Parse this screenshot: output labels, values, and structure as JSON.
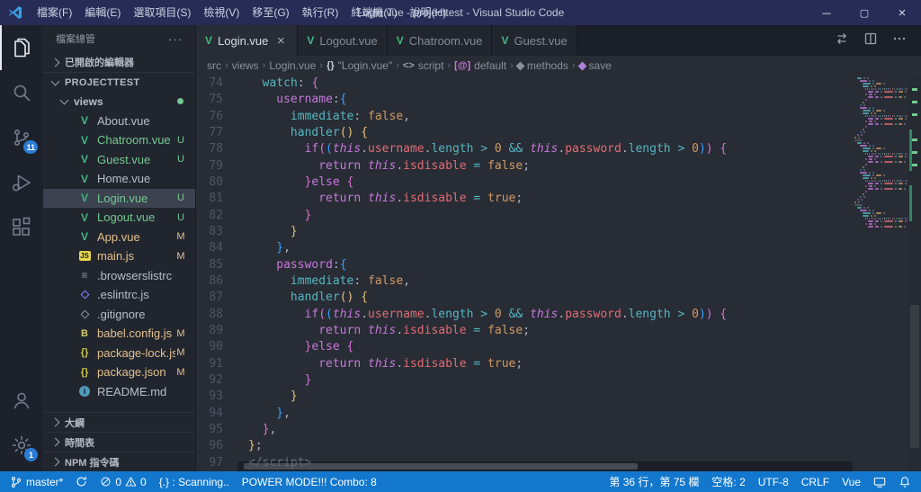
{
  "title_bar": {
    "title": "Login.vue - projecttest - Visual Studio Code",
    "menus": [
      "檔案(F)",
      "編輯(E)",
      "選取項目(S)",
      "檢視(V)",
      "移至(G)",
      "執行(R)",
      "終端機(T)",
      "說明(H)"
    ]
  },
  "activity_bar": {
    "scm_badge": "11",
    "settings_badge": "1",
    "icons": [
      "files",
      "search",
      "source-control",
      "run-and-debug",
      "extensions",
      "account",
      "settings"
    ]
  },
  "sidebar": {
    "title": "檔案總管",
    "sections": {
      "open_editors": "已開啟的編輯器",
      "project": "PROJECTTEST",
      "outline": "大綱",
      "timeline": "時間表",
      "npm_scripts": "NPM 指令碼"
    },
    "tree": [
      {
        "label": "views",
        "type": "folder",
        "expanded": true,
        "dot": true
      },
      {
        "label": "About.vue",
        "type": "vue",
        "badge": ""
      },
      {
        "label": "Chatroom.vue",
        "type": "vue",
        "badge": "U"
      },
      {
        "label": "Guest.vue",
        "type": "vue",
        "badge": "U"
      },
      {
        "label": "Home.vue",
        "type": "vue",
        "badge": ""
      },
      {
        "label": "Login.vue",
        "type": "vue",
        "badge": "U",
        "selected": true
      },
      {
        "label": "Logout.vue",
        "type": "vue",
        "badge": "U"
      },
      {
        "label": "App.vue",
        "type": "vue",
        "badge": "M"
      },
      {
        "label": "main.js",
        "type": "js",
        "badge": "M"
      },
      {
        "label": ".browserslistrc",
        "type": "cfg",
        "badge": ""
      },
      {
        "label": ".eslintrc.js",
        "type": "eslint",
        "badge": ""
      },
      {
        "label": ".gitignore",
        "type": "git",
        "badge": ""
      },
      {
        "label": "babel.config.js",
        "type": "babel",
        "badge": "M"
      },
      {
        "label": "package-lock.json",
        "type": "json",
        "badge": "M"
      },
      {
        "label": "package.json",
        "type": "json",
        "badge": "M"
      },
      {
        "label": "README.md",
        "type": "md",
        "badge": ""
      }
    ]
  },
  "tabs": [
    {
      "label": "Login.vue",
      "active": true
    },
    {
      "label": "Logout.vue",
      "active": false
    },
    {
      "label": "Chatroom.vue",
      "active": false
    },
    {
      "label": "Guest.vue",
      "active": false
    }
  ],
  "breadcrumbs": [
    {
      "label": "src",
      "icon": ""
    },
    {
      "label": "views",
      "icon": ""
    },
    {
      "label": "Login.vue",
      "icon": ""
    },
    {
      "label": "\"Login.vue\"",
      "icon": "braces"
    },
    {
      "label": "script",
      "icon": "angle"
    },
    {
      "label": "default",
      "icon": "at"
    },
    {
      "label": "methods",
      "icon": "wrench"
    },
    {
      "label": "save",
      "icon": "method"
    }
  ],
  "editor": {
    "lines": [
      {
        "n": 74,
        "i": 1,
        "t": [
          [
            "watch",
            "c"
          ],
          [
            ": ",
            "f"
          ],
          [
            "{",
            "p"
          ]
        ]
      },
      {
        "n": 75,
        "i": 2,
        "t": [
          [
            "username",
            "k"
          ],
          [
            ":",
            "f"
          ],
          [
            "{",
            "b"
          ]
        ]
      },
      {
        "n": 76,
        "i": 3,
        "t": [
          [
            "immediate",
            "c"
          ],
          [
            ": ",
            "f"
          ],
          [
            "false",
            "o"
          ],
          [
            ",",
            "f"
          ]
        ]
      },
      {
        "n": 77,
        "i": 3,
        "t": [
          [
            "handler",
            "c"
          ],
          [
            "()",
            "g"
          ],
          [
            " ",
            "f"
          ],
          [
            "{",
            "g"
          ]
        ]
      },
      {
        "n": 78,
        "i": 4,
        "t": [
          [
            "if",
            "k"
          ],
          [
            "(",
            "p"
          ],
          [
            "(",
            "b"
          ],
          [
            "this",
            "t"
          ],
          [
            ".",
            "f"
          ],
          [
            "username",
            "r"
          ],
          [
            ".",
            "f"
          ],
          [
            "length",
            "c"
          ],
          [
            " > ",
            "c"
          ],
          [
            "0",
            "o"
          ],
          [
            " && ",
            "c"
          ],
          [
            "this",
            "t"
          ],
          [
            ".",
            "f"
          ],
          [
            "password",
            "r"
          ],
          [
            ".",
            "f"
          ],
          [
            "length",
            "c"
          ],
          [
            " > ",
            "c"
          ],
          [
            "0",
            "o"
          ],
          [
            ")",
            "b"
          ],
          [
            ")",
            "p"
          ],
          [
            " ",
            "f"
          ],
          [
            "{",
            "p"
          ]
        ]
      },
      {
        "n": 79,
        "i": 5,
        "t": [
          [
            "return",
            "k"
          ],
          [
            " ",
            "f"
          ],
          [
            "this",
            "t"
          ],
          [
            ".",
            "f"
          ],
          [
            "isdisable",
            "r"
          ],
          [
            " ",
            "f"
          ],
          [
            "=",
            "c"
          ],
          [
            " ",
            "f"
          ],
          [
            "false",
            "o"
          ],
          [
            ";",
            "f"
          ]
        ]
      },
      {
        "n": 80,
        "i": 4,
        "t": [
          [
            "}",
            "p"
          ],
          [
            "else",
            "k"
          ],
          [
            " ",
            "f"
          ],
          [
            "{",
            "p"
          ]
        ]
      },
      {
        "n": 81,
        "i": 5,
        "t": [
          [
            "return",
            "k"
          ],
          [
            " ",
            "f"
          ],
          [
            "this",
            "t"
          ],
          [
            ".",
            "f"
          ],
          [
            "isdisable",
            "r"
          ],
          [
            " ",
            "f"
          ],
          [
            "=",
            "c"
          ],
          [
            " ",
            "f"
          ],
          [
            "true",
            "o"
          ],
          [
            ";",
            "f"
          ]
        ]
      },
      {
        "n": 82,
        "i": 4,
        "t": [
          [
            "}",
            "p"
          ]
        ]
      },
      {
        "n": 83,
        "i": 3,
        "t": [
          [
            "}",
            "g"
          ]
        ]
      },
      {
        "n": 84,
        "i": 2,
        "t": [
          [
            "}",
            "b"
          ],
          [
            ",",
            "f"
          ]
        ]
      },
      {
        "n": 85,
        "i": 2,
        "t": [
          [
            "password",
            "k"
          ],
          [
            ":",
            "f"
          ],
          [
            "{",
            "b"
          ]
        ]
      },
      {
        "n": 86,
        "i": 3,
        "t": [
          [
            "immediate",
            "c"
          ],
          [
            ": ",
            "f"
          ],
          [
            "false",
            "o"
          ],
          [
            ",",
            "f"
          ]
        ]
      },
      {
        "n": 87,
        "i": 3,
        "t": [
          [
            "handler",
            "c"
          ],
          [
            "()",
            "g"
          ],
          [
            " ",
            "f"
          ],
          [
            "{",
            "g"
          ]
        ]
      },
      {
        "n": 88,
        "i": 4,
        "t": [
          [
            "if",
            "k"
          ],
          [
            "(",
            "p"
          ],
          [
            "(",
            "b"
          ],
          [
            "this",
            "t"
          ],
          [
            ".",
            "f"
          ],
          [
            "username",
            "r"
          ],
          [
            ".",
            "f"
          ],
          [
            "length",
            "c"
          ],
          [
            " > ",
            "c"
          ],
          [
            "0",
            "o"
          ],
          [
            " && ",
            "c"
          ],
          [
            "this",
            "t"
          ],
          [
            ".",
            "f"
          ],
          [
            "password",
            "r"
          ],
          [
            ".",
            "f"
          ],
          [
            "length",
            "c"
          ],
          [
            " > ",
            "c"
          ],
          [
            "0",
            "o"
          ],
          [
            ")",
            "b"
          ],
          [
            ")",
            "p"
          ],
          [
            " ",
            "f"
          ],
          [
            "{",
            "p"
          ]
        ]
      },
      {
        "n": 89,
        "i": 5,
        "t": [
          [
            "return",
            "k"
          ],
          [
            " ",
            "f"
          ],
          [
            "this",
            "t"
          ],
          [
            ".",
            "f"
          ],
          [
            "isdisable",
            "r"
          ],
          [
            " ",
            "f"
          ],
          [
            "=",
            "c"
          ],
          [
            " ",
            "f"
          ],
          [
            "false",
            "o"
          ],
          [
            ";",
            "f"
          ]
        ]
      },
      {
        "n": 90,
        "i": 4,
        "t": [
          [
            "}",
            "p"
          ],
          [
            "else",
            "k"
          ],
          [
            " ",
            "f"
          ],
          [
            "{",
            "p"
          ]
        ]
      },
      {
        "n": 91,
        "i": 5,
        "t": [
          [
            "return",
            "k"
          ],
          [
            " ",
            "f"
          ],
          [
            "this",
            "t"
          ],
          [
            ".",
            "f"
          ],
          [
            "isdisable",
            "r"
          ],
          [
            " ",
            "f"
          ],
          [
            "=",
            "c"
          ],
          [
            " ",
            "f"
          ],
          [
            "true",
            "o"
          ],
          [
            ";",
            "f"
          ]
        ]
      },
      {
        "n": 92,
        "i": 4,
        "t": [
          [
            "}",
            "p"
          ]
        ]
      },
      {
        "n": 93,
        "i": 3,
        "t": [
          [
            "}",
            "g"
          ]
        ]
      },
      {
        "n": 94,
        "i": 2,
        "t": [
          [
            "}",
            "b"
          ],
          [
            ",",
            "f"
          ]
        ]
      },
      {
        "n": 95,
        "i": 1,
        "t": [
          [
            "}",
            "p"
          ],
          [
            ",",
            "f"
          ]
        ]
      },
      {
        "n": 96,
        "i": 0,
        "t": [
          [
            "}",
            "g"
          ],
          [
            ";",
            "f"
          ]
        ]
      },
      {
        "n": 97,
        "i": 0,
        "t": [
          [
            "</script>",
            "d"
          ]
        ]
      }
    ]
  },
  "status_bar": {
    "branch": "master*",
    "errors": "0",
    "warnings": "0",
    "scanning": "{.} : Scanning..",
    "power": "POWER MODE!!! Combo: 8",
    "line_col": "第 36 行，第 75 欄",
    "indent": "空格: 2",
    "encoding": "UTF-8",
    "eol": "CRLF",
    "language": "Vue"
  }
}
